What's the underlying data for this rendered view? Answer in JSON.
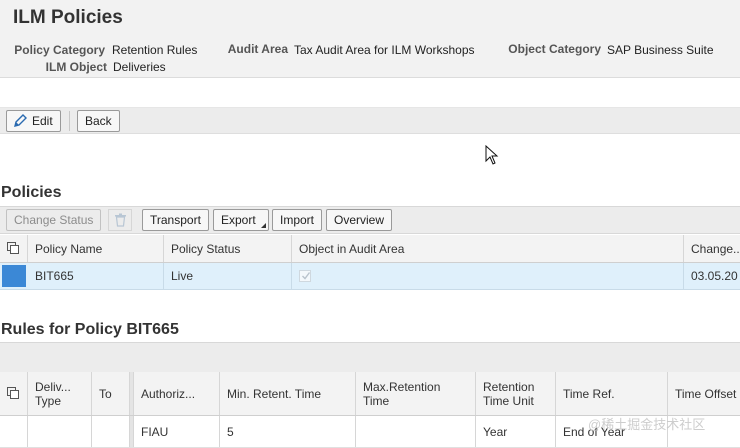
{
  "app": {
    "title": "ILM Policies"
  },
  "header_fields": {
    "policy_category_label": "Policy Category",
    "policy_category_value": "Retention Rules",
    "audit_area_label": "Audit Area",
    "audit_area_value": "Tax Audit Area for ILM Workshops",
    "object_category_label": "Object Category",
    "object_category_value": "SAP Business Suite",
    "ilm_object_label": "ILM Object",
    "ilm_object_value": "Deliveries"
  },
  "toolbar": {
    "edit_label": "Edit",
    "back_label": "Back"
  },
  "policies": {
    "title": "Policies",
    "toolbar": {
      "change_status": "Change Status",
      "transport": "Transport",
      "export": "Export",
      "import": "Import",
      "overview": "Overview"
    },
    "columns": [
      "Policy Name",
      "Policy Status",
      "Object in Audit Area",
      "Change..."
    ],
    "rows": [
      {
        "policy_name": "BIT665",
        "policy_status": "Live",
        "object_in_audit_area_checked": true,
        "changed": "03.05.20"
      }
    ]
  },
  "rules": {
    "title": "Rules for Policy BIT665",
    "columns": [
      "Deliv... Type",
      "To",
      "Authoriz...",
      "Min. Retent. Time",
      "Max.Retention Time",
      "Retention Time Unit",
      "Time Ref.",
      "Time Offset"
    ],
    "rows": [
      {
        "deliv_type": "",
        "to": "",
        "authoriz": "FIAU",
        "min_retent": "5",
        "max_retention": "",
        "unit": "Year",
        "time_ref": "End of Year",
        "time_offset": ""
      }
    ]
  },
  "watermark": "@稀土掘金技术社区",
  "colors": {
    "selection_blue": "#3b88d6",
    "selected_row": "#dff0fb"
  }
}
